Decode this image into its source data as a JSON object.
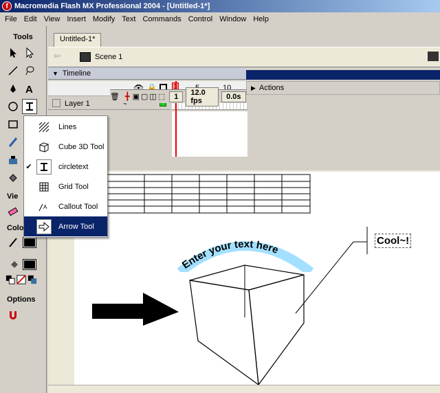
{
  "window": {
    "title": "Macromedia Flash MX Professional 2004 - [Untitled-1*]",
    "app_icon": "flash-icon"
  },
  "menu": [
    "File",
    "Edit",
    "View",
    "Insert",
    "Modify",
    "Text",
    "Commands",
    "Control",
    "Window",
    "Help"
  ],
  "tools_panel": {
    "header": "Tools",
    "view_label": "Vie",
    "colors_label": "Colo",
    "options_label": "Options",
    "stroke_color": "#000000",
    "fill_color": "#000000"
  },
  "document": {
    "tab_label": "Untitled-1*",
    "scene_label": "Scene 1"
  },
  "timeline": {
    "title": "Timeline",
    "frame_numbers": [
      "1",
      "5",
      "10"
    ],
    "layer_name": "Layer 1",
    "current_frame": "1",
    "fps": "12.0 fps",
    "elapsed": "0.0s"
  },
  "actions_panel": {
    "title": "Actions"
  },
  "context_menu": {
    "items": [
      {
        "label": "Lines",
        "icon": "lines-icon",
        "checked": false,
        "highlighted": false
      },
      {
        "label": "Cube 3D Tool",
        "icon": "cube-icon",
        "checked": false,
        "highlighted": false
      },
      {
        "label": "circletext",
        "icon": "circletext-icon",
        "checked": true,
        "highlighted": false
      },
      {
        "label": "Grid Tool",
        "icon": "grid-icon",
        "checked": false,
        "highlighted": false
      },
      {
        "label": "Callout Tool",
        "icon": "callout-icon",
        "checked": false,
        "highlighted": false
      },
      {
        "label": "Arrow Tool",
        "icon": "arrow-tool-icon",
        "checked": false,
        "highlighted": true
      }
    ]
  },
  "stage": {
    "curved_text": "Enter your text here",
    "callout_text": "Cool~!",
    "grid": {
      "rows": 6,
      "cols": 8
    }
  }
}
